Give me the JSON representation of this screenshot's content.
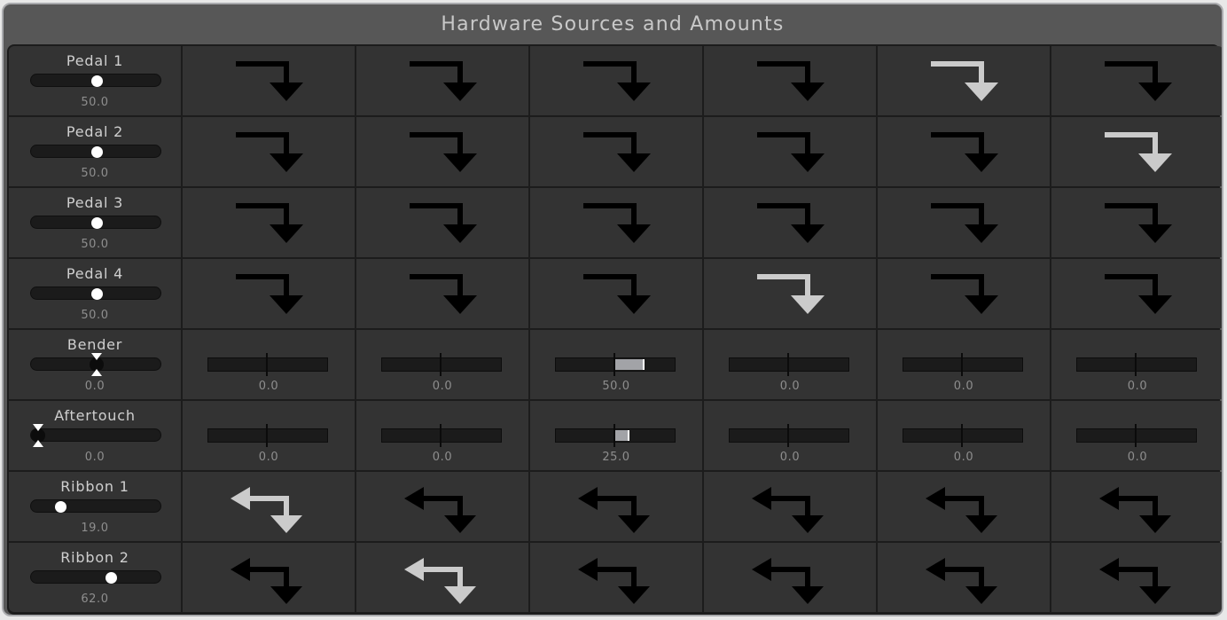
{
  "window": {
    "title": "Hardware Sources and Amounts"
  },
  "colors": {
    "arrow_active": "#cbcbcb",
    "arrow_inactive": "#000000",
    "amount_fill": "#a2a3a7"
  },
  "sources": [
    {
      "name": "Pedal 1",
      "value": "50.0",
      "position": 0.5,
      "type": "unipolar",
      "cells": [
        {
          "kind": "route",
          "icon": "route-arrow-icon",
          "active": false
        },
        {
          "kind": "route",
          "icon": "route-arrow-icon",
          "active": false
        },
        {
          "kind": "route",
          "icon": "route-arrow-icon",
          "active": false
        },
        {
          "kind": "route",
          "icon": "route-arrow-icon",
          "active": false
        },
        {
          "kind": "route",
          "icon": "route-arrow-icon",
          "active": true
        },
        {
          "kind": "route",
          "icon": "route-arrow-icon",
          "active": false
        }
      ]
    },
    {
      "name": "Pedal 2",
      "value": "50.0",
      "position": 0.5,
      "type": "unipolar",
      "cells": [
        {
          "kind": "route",
          "icon": "route-arrow-icon",
          "active": false
        },
        {
          "kind": "route",
          "icon": "route-arrow-icon",
          "active": false
        },
        {
          "kind": "route",
          "icon": "route-arrow-icon",
          "active": false
        },
        {
          "kind": "route",
          "icon": "route-arrow-icon",
          "active": false
        },
        {
          "kind": "route",
          "icon": "route-arrow-icon",
          "active": false
        },
        {
          "kind": "route",
          "icon": "route-arrow-icon",
          "active": true
        }
      ]
    },
    {
      "name": "Pedal 3",
      "value": "50.0",
      "position": 0.5,
      "type": "unipolar",
      "cells": [
        {
          "kind": "route",
          "icon": "route-arrow-icon",
          "active": false
        },
        {
          "kind": "route",
          "icon": "route-arrow-icon",
          "active": false
        },
        {
          "kind": "route",
          "icon": "route-arrow-icon",
          "active": false
        },
        {
          "kind": "route",
          "icon": "route-arrow-icon",
          "active": false
        },
        {
          "kind": "route",
          "icon": "route-arrow-icon",
          "active": false
        },
        {
          "kind": "route",
          "icon": "route-arrow-icon",
          "active": false
        }
      ]
    },
    {
      "name": "Pedal 4",
      "value": "50.0",
      "position": 0.5,
      "type": "unipolar",
      "cells": [
        {
          "kind": "route",
          "icon": "route-arrow-icon",
          "active": false
        },
        {
          "kind": "route",
          "icon": "route-arrow-icon",
          "active": false
        },
        {
          "kind": "route",
          "icon": "route-arrow-icon",
          "active": false
        },
        {
          "kind": "route",
          "icon": "route-arrow-icon",
          "active": true
        },
        {
          "kind": "route",
          "icon": "route-arrow-icon",
          "active": false
        },
        {
          "kind": "route",
          "icon": "route-arrow-icon",
          "active": false
        }
      ]
    },
    {
      "name": "Bender",
      "value": "0.0",
      "position": 0.5,
      "type": "bipolar",
      "cells": [
        {
          "kind": "amount",
          "value": "0.0",
          "amount": 0
        },
        {
          "kind": "amount",
          "value": "0.0",
          "amount": 0
        },
        {
          "kind": "amount",
          "value": "50.0",
          "amount": 50
        },
        {
          "kind": "amount",
          "value": "0.0",
          "amount": 0
        },
        {
          "kind": "amount",
          "value": "0.0",
          "amount": 0
        },
        {
          "kind": "amount",
          "value": "0.0",
          "amount": 0
        }
      ]
    },
    {
      "name": "Aftertouch",
      "value": "0.0",
      "position": 0.0,
      "type": "bipolar",
      "cells": [
        {
          "kind": "amount",
          "value": "0.0",
          "amount": 0
        },
        {
          "kind": "amount",
          "value": "0.0",
          "amount": 0
        },
        {
          "kind": "amount",
          "value": "25.0",
          "amount": 25
        },
        {
          "kind": "amount",
          "value": "0.0",
          "amount": 0
        },
        {
          "kind": "amount",
          "value": "0.0",
          "amount": 0
        },
        {
          "kind": "amount",
          "value": "0.0",
          "amount": 0
        }
      ]
    },
    {
      "name": "Ribbon 1",
      "value": "19.0",
      "position": 0.19,
      "type": "unipolar",
      "cells": [
        {
          "kind": "return",
          "icon": "return-route-arrow-icon",
          "active": true
        },
        {
          "kind": "return",
          "icon": "return-route-arrow-icon",
          "active": false
        },
        {
          "kind": "return",
          "icon": "return-route-arrow-icon",
          "active": false
        },
        {
          "kind": "return",
          "icon": "return-route-arrow-icon",
          "active": false
        },
        {
          "kind": "return",
          "icon": "return-route-arrow-icon",
          "active": false
        },
        {
          "kind": "return",
          "icon": "return-route-arrow-icon",
          "active": false
        }
      ]
    },
    {
      "name": "Ribbon 2",
      "value": "62.0",
      "position": 0.62,
      "type": "unipolar",
      "cells": [
        {
          "kind": "return",
          "icon": "return-route-arrow-icon",
          "active": false
        },
        {
          "kind": "return",
          "icon": "return-route-arrow-icon",
          "active": true
        },
        {
          "kind": "return",
          "icon": "return-route-arrow-icon",
          "active": false
        },
        {
          "kind": "return",
          "icon": "return-route-arrow-icon",
          "active": false
        },
        {
          "kind": "return",
          "icon": "return-route-arrow-icon",
          "active": false
        },
        {
          "kind": "return",
          "icon": "return-route-arrow-icon",
          "active": false
        }
      ]
    }
  ]
}
